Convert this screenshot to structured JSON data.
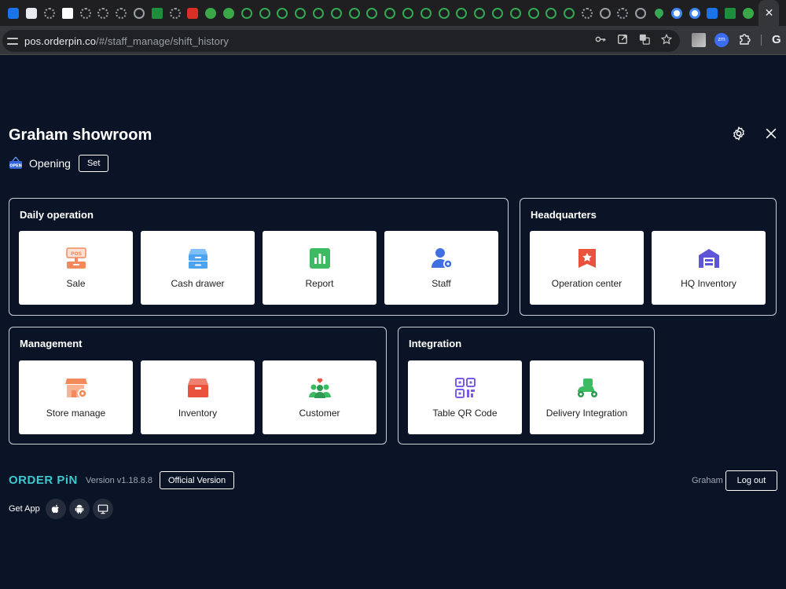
{
  "browser": {
    "url_host": "pos.orderpin.co",
    "url_path": "/#/staff_manage/shift_history"
  },
  "store": {
    "name": "Graham showroom",
    "status": "Opening",
    "set_label": "Set",
    "open_badge_text": "OPEN"
  },
  "daily_operation": {
    "title": "Daily operation",
    "cards": [
      {
        "label": "Sale",
        "icon": "pos-icon"
      },
      {
        "label": "Cash drawer",
        "icon": "cash-drawer-icon"
      },
      {
        "label": "Report",
        "icon": "report-icon"
      },
      {
        "label": "Staff",
        "icon": "staff-icon"
      }
    ]
  },
  "headquarters": {
    "title": "Headquarters",
    "cards": [
      {
        "label": "Operation center",
        "icon": "operation-center-icon"
      },
      {
        "label": "HQ Inventory",
        "icon": "hq-inventory-icon"
      }
    ]
  },
  "management": {
    "title": "Management",
    "cards": [
      {
        "label": "Store manage",
        "icon": "store-manage-icon"
      },
      {
        "label": "Inventory",
        "icon": "inventory-icon"
      },
      {
        "label": "Customer",
        "icon": "customer-icon"
      }
    ]
  },
  "integration": {
    "title": "Integration",
    "cards": [
      {
        "label": "Table QR Code",
        "icon": "qr-code-icon"
      },
      {
        "label": "Delivery Integration",
        "icon": "delivery-icon"
      }
    ]
  },
  "footer": {
    "logo": "ORDER PiN",
    "version": "Version v1.18.8.8",
    "official_label": "Official Version",
    "user": "Graham",
    "logout_label": "Log out",
    "get_app_label": "Get App"
  },
  "colors": {
    "background": "#0b1426",
    "sale": "#f28a5b",
    "cash_drawer": "#4da3f0",
    "report": "#3dbb63",
    "staff": "#3f6fe0",
    "operation_center": "#e9533d",
    "hq_inventory": "#5d56d9",
    "store_manage": "#f28a5b",
    "inventory": "#e9533d",
    "customer": "#3dbb63",
    "qr_code": "#7b5be6",
    "delivery": "#3dbb63",
    "logo": "#3bc9cd"
  }
}
